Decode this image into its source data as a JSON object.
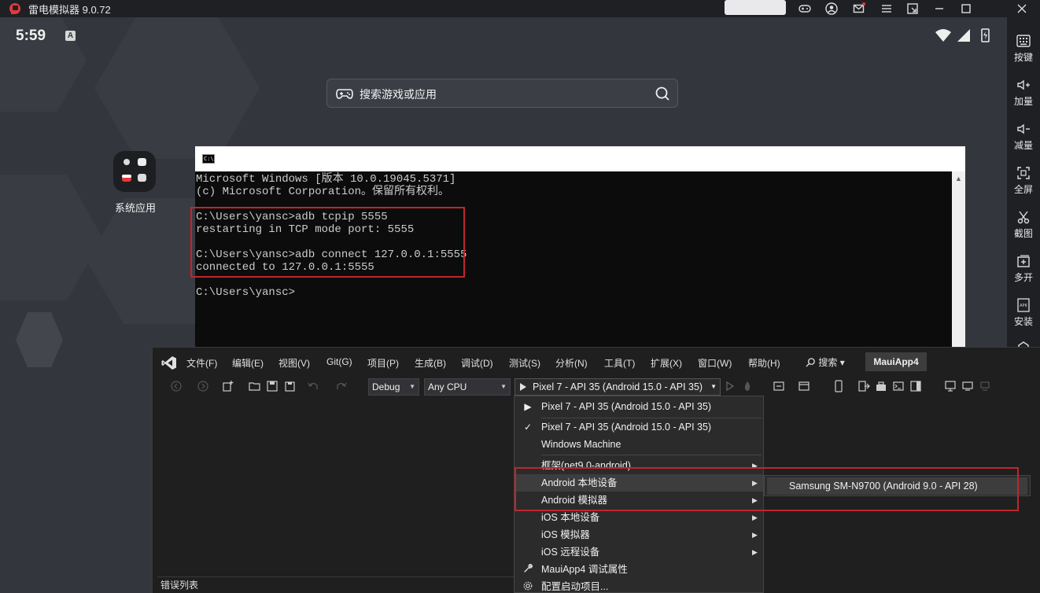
{
  "emulator": {
    "title": "雷电模拟器 9.0.72"
  },
  "android": {
    "time": "5:59",
    "notif_letter": "A",
    "search_placeholder": "搜索游戏或应用",
    "system_app_label": "系统应用"
  },
  "sidebar": {
    "items": [
      {
        "label": "按键",
        "icon": "keyboard-icon"
      },
      {
        "label": "加量",
        "icon": "volume-up-icon"
      },
      {
        "label": "减量",
        "icon": "volume-down-icon"
      },
      {
        "label": "全屏",
        "icon": "fullscreen-icon"
      },
      {
        "label": "截图",
        "icon": "scissors-icon"
      },
      {
        "label": "多开",
        "icon": "multi-instance-icon"
      },
      {
        "label": "安装",
        "icon": "apk-icon"
      }
    ]
  },
  "cmd": {
    "lines": [
      "Microsoft Windows [版本 10.0.19045.5371]",
      "(c) Microsoft Corporation。保留所有权利。",
      "",
      "C:\\Users\\yansc>adb tcpip 5555",
      "restarting in TCP mode port: 5555",
      "",
      "C:\\Users\\yansc>adb connect 127.0.0.1:5555",
      "connected to 127.0.0.1:5555",
      "",
      "C:\\Users\\yansc>"
    ]
  },
  "vs": {
    "menu": [
      "文件(F)",
      "编辑(E)",
      "视图(V)",
      "Git(G)",
      "项目(P)",
      "生成(B)",
      "调试(D)",
      "测试(S)",
      "分析(N)",
      "工具(T)",
      "扩展(X)",
      "窗口(W)",
      "帮助(H)"
    ],
    "search_label": "搜索",
    "project_name": "MauiApp4",
    "config": "Debug",
    "platform": "Any CPU",
    "run_target": "Pixel 7 - API 35 (Android 15.0 - API 35)",
    "status_tab": "错误列表"
  },
  "dropdown": {
    "items": [
      {
        "label": "Pixel 7 - API 35 (Android 15.0 - API 35)",
        "icon": "play-icon",
        "arrow": false
      },
      {
        "label": "Pixel 7 - API 35 (Android 15.0 - API 35)",
        "icon": "check-icon",
        "arrow": false
      },
      {
        "label": "Windows Machine",
        "icon": "",
        "arrow": false
      },
      {
        "label": "框架(net9.0-android)",
        "icon": "",
        "arrow": true
      },
      {
        "label": "Android 本地设备",
        "icon": "",
        "arrow": true
      },
      {
        "label": "Android 模拟器",
        "icon": "",
        "arrow": true
      },
      {
        "label": "iOS 本地设备",
        "icon": "",
        "arrow": true
      },
      {
        "label": "iOS 模拟器",
        "icon": "",
        "arrow": true
      },
      {
        "label": "iOS 远程设备",
        "icon": "",
        "arrow": true
      },
      {
        "label": "MauiApp4 调试属性",
        "icon": "wrench-icon",
        "arrow": false
      },
      {
        "label": "配置启动项目...",
        "icon": "gear-icon",
        "arrow": false
      }
    ],
    "submenu_item": "Samsung SM-N9700 (Android 9.0 - API 28)"
  },
  "colors": {
    "highlight_red": "#c0262d",
    "vs_background": "#1f1f1f",
    "android_background": "#34363d"
  }
}
